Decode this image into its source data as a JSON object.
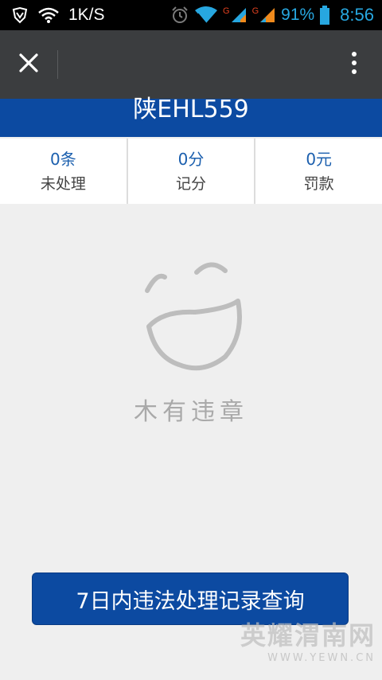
{
  "status_bar": {
    "network_speed": "1K/S",
    "sim1_label": "G",
    "sim2_label": "G",
    "battery": "91%",
    "time": "8:56"
  },
  "app_bar": {
    "close_icon": "close-icon",
    "more_icon": "more-vertical-icon"
  },
  "plate": "陕EHL559",
  "stats": [
    {
      "value": "0条",
      "label": "未处理"
    },
    {
      "value": "0分",
      "label": "记分"
    },
    {
      "value": "0元",
      "label": "罚款"
    }
  ],
  "empty_state": {
    "icon": "smiley-face-icon",
    "text": "木有违章"
  },
  "query_button": "7日内违法处理记录查询",
  "watermark": {
    "main": "英耀渭南网",
    "sub": "WWW.YEWN.CN"
  },
  "colors": {
    "brand_blue": "#0c4aa1",
    "app_bar": "#3b3d3f",
    "status_accent": "#27a7e0"
  }
}
